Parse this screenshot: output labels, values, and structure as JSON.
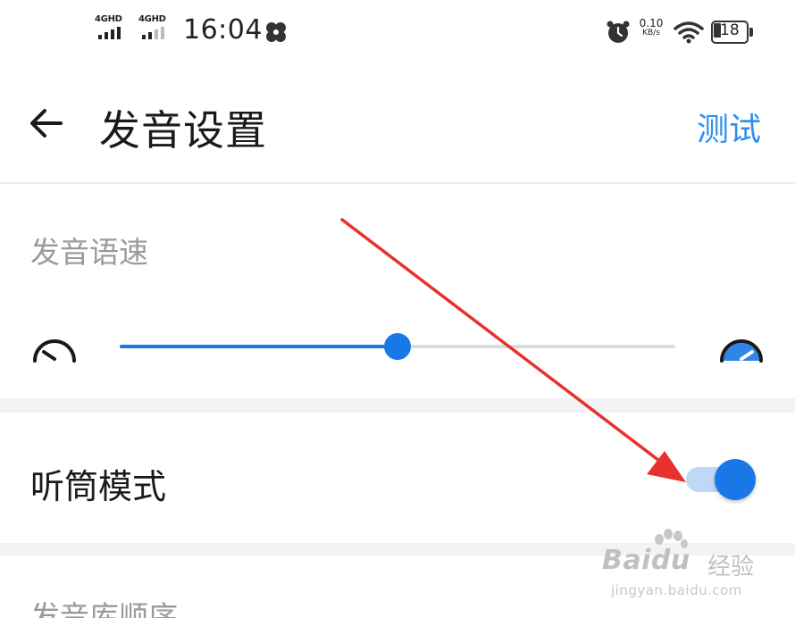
{
  "status_bar": {
    "sim1_label": "4GHD",
    "sim2_label": "4GHD",
    "time": "16:04",
    "net_speed_value": "0.10",
    "net_speed_unit": "KB/s",
    "battery_percent": "18",
    "icons": [
      "signal-icon",
      "signal-icon",
      "app-notification-icon",
      "alarm-icon",
      "wifi-icon",
      "battery-icon"
    ]
  },
  "header": {
    "back_icon": "back-arrow-icon",
    "title": "发音设置",
    "action_label": "测试"
  },
  "speech_speed": {
    "label": "发音语速",
    "slow_icon": "slow-speed-icon",
    "fast_icon": "fast-speed-icon",
    "value_fraction": 0.5
  },
  "earpiece_mode": {
    "label": "听筒模式",
    "enabled": true
  },
  "next_setting": {
    "label": "发音库顺序"
  },
  "watermark": {
    "logo_text": "Baidu",
    "logo_cn": "经验",
    "url": "jingyan.baidu.com"
  },
  "colors": {
    "accent": "#1a78e6",
    "test_link": "#2f8ff0",
    "arrow": "#e8302c"
  }
}
